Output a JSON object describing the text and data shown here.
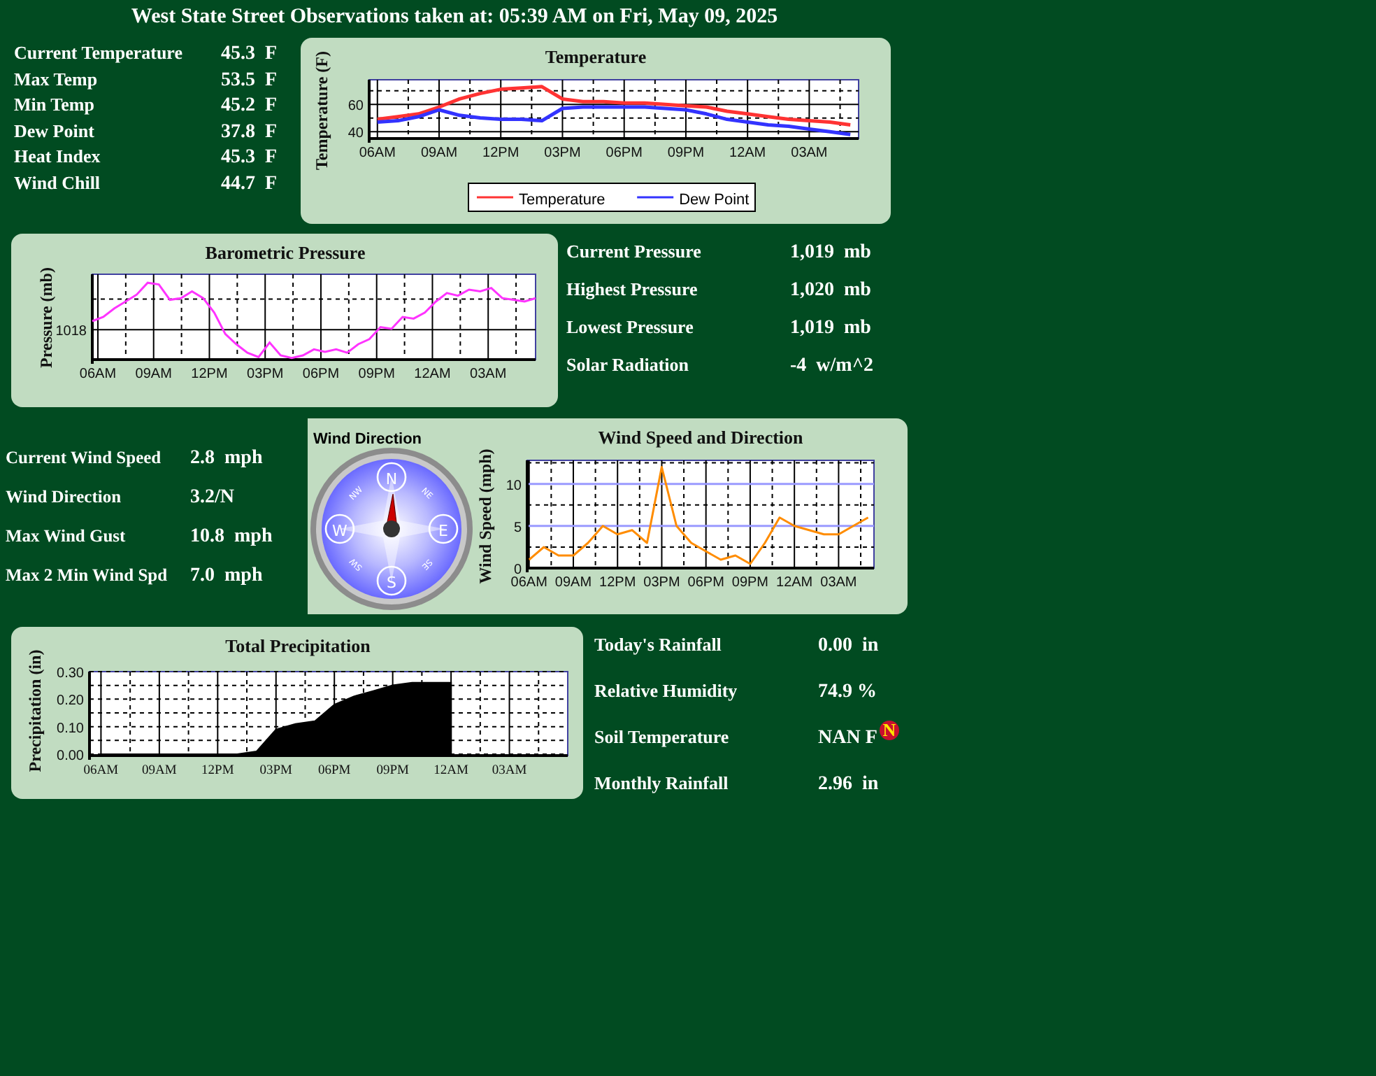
{
  "title": "West State Street Observations taken at: 05:39 AM on Fri, May 09, 2025",
  "temperature_stats": [
    {
      "label": "Current Temperature",
      "value": "45.3  F"
    },
    {
      "label": "Max Temp",
      "value": "53.5  F"
    },
    {
      "label": "Min Temp",
      "value": "45.2  F"
    },
    {
      "label": "Dew Point",
      "value": "37.8  F"
    },
    {
      "label": "Heat Index",
      "value": "45.3  F"
    },
    {
      "label": "Wind Chill",
      "value": "44.7  F"
    }
  ],
  "temperature_chart": {
    "chart_data": {
      "type": "line",
      "title": "Temperature",
      "ylabel": "Temperature (F)",
      "categories": [
        "06AM",
        null,
        null,
        "09AM",
        null,
        null,
        "12PM",
        null,
        null,
        "03PM",
        null,
        null,
        "06PM",
        null,
        null,
        "09PM",
        null,
        null,
        "12AM",
        null,
        null,
        "03AM",
        null,
        null
      ],
      "series": [
        {
          "name": "Temperature",
          "color": "#ff3333",
          "values": [
            49,
            51,
            53,
            58,
            64,
            68,
            71,
            72,
            73,
            64,
            62,
            62,
            61,
            61,
            60,
            59,
            58,
            55,
            53,
            51,
            49,
            48,
            47,
            45
          ]
        },
        {
          "name": "Dew Point",
          "color": "#3333ff",
          "values": [
            47,
            48,
            51,
            56,
            52,
            50,
            49,
            49,
            48,
            57,
            58,
            58,
            58,
            58,
            57,
            56,
            53,
            49,
            47,
            45,
            44,
            42,
            40,
            38
          ]
        }
      ],
      "ylim": [
        35,
        78
      ],
      "grid": true,
      "legend": "bottom",
      "yticks": [
        40,
        60
      ]
    }
  },
  "pressure_chart": {
    "title": "Barometric Pressure",
    "ylabel": "Pressure (mb)",
    "ytick_label": "1018",
    "xtick_labels": [
      "06AM",
      "09AM",
      "12PM",
      "03PM",
      "06PM",
      "09PM",
      "12AM",
      "03AM"
    ]
  },
  "pressure_stats": [
    {
      "label": "Current Pressure",
      "value": "1,019  mb"
    },
    {
      "label": "Highest Pressure",
      "value": "1,020  mb"
    },
    {
      "label": "Lowest Pressure",
      "value": "1,019  mb"
    },
    {
      "label": "Solar Radiation",
      "value": "-4  w/m^2"
    }
  ],
  "wind_stats": [
    {
      "label": "Current Wind Speed",
      "value": "2.8  mph"
    },
    {
      "label": "Wind Direction",
      "value": "3.2/N"
    },
    {
      "label": "Max Wind Gust",
      "value": "10.8  mph"
    },
    {
      "label": "Max 2 Min Wind Spd",
      "value": "7.0  mph"
    }
  ],
  "wind_compass": {
    "title": "Wind Direction",
    "labels": [
      {
        "text": "N",
        "kind": "major"
      },
      {
        "text": "NE",
        "kind": "minor"
      },
      {
        "text": "E",
        "kind": "major"
      },
      {
        "text": "SE",
        "kind": "minor"
      },
      {
        "text": "S",
        "kind": "major"
      },
      {
        "text": "SW",
        "kind": "minor"
      },
      {
        "text": "W",
        "kind": "major"
      },
      {
        "text": "NW",
        "kind": "minor"
      }
    ]
  },
  "wind_chart": {
    "chart_data": {
      "type": "line",
      "title": "Wind Speed and Direction",
      "ylabel": "Wind Speed (mph)",
      "categories": [
        "06AM",
        null,
        null,
        "09AM",
        null,
        null,
        "12PM",
        null,
        null,
        "03PM",
        null,
        null,
        "06PM",
        null,
        null,
        "09PM",
        null,
        null,
        "12AM",
        null,
        null,
        "03AM",
        null,
        null
      ],
      "series": [
        {
          "color": "#ff8c00",
          "values": [
            1,
            2.5,
            1.5,
            1.5,
            3,
            5,
            4,
            4.5,
            3,
            12,
            5,
            3,
            2,
            1,
            1.5,
            0.5,
            3,
            6,
            5,
            4.5,
            4,
            4,
            5,
            6
          ]
        }
      ],
      "ylim": [
        0,
        12.8
      ],
      "grid": true,
      "yticks": [
        0,
        5,
        10
      ]
    }
  },
  "precipitation_chart": {
    "chart_data": {
      "type": "area",
      "title": "Total Precipitation",
      "ylabel": "Precipitation (in)",
      "categories": [
        "06AM",
        null,
        null,
        "09AM",
        null,
        null,
        "12PM",
        null,
        null,
        "03PM",
        null,
        null,
        "06PM",
        null,
        null,
        "09PM",
        null,
        null,
        "12AM",
        null,
        null,
        "03AM",
        null,
        null
      ],
      "series": [
        {
          "color": "#000000",
          "values": [
            0,
            0,
            0,
            0,
            0,
            0,
            0,
            0,
            0.01,
            0.09,
            0.11,
            0.12,
            0.18,
            0.21,
            0.23,
            0.25,
            0.26,
            0.26,
            0.26,
            null,
            null,
            null,
            null,
            null
          ]
        }
      ],
      "ylim": [
        -0.005,
        0.3
      ],
      "grid": true,
      "yticks": [
        {
          "value": 0,
          "label": "0.00"
        },
        {
          "value": 0.1,
          "label": "0.10"
        },
        {
          "value": 0.2,
          "label": "0.20"
        },
        {
          "value": 0.3,
          "label": "0.30"
        }
      ]
    }
  },
  "rain_stats": [
    {
      "label": "Today's Rainfall",
      "value": "0.00  in"
    },
    {
      "label": "Relative Humidity",
      "value": "74.9 %"
    },
    {
      "label": "Soil Temperature",
      "value": "NAN F",
      "badge": "N"
    },
    {
      "label": "Monthly Rainfall",
      "value": "2.96  in"
    }
  ]
}
